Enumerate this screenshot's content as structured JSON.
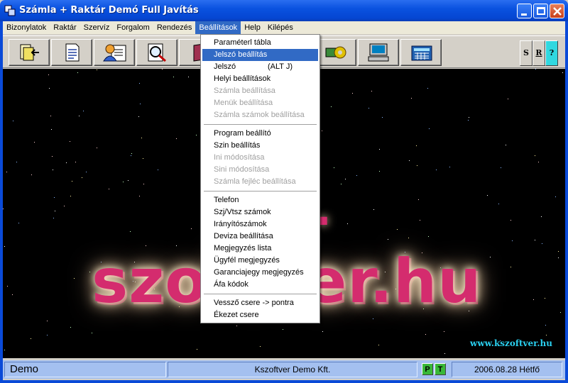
{
  "window": {
    "title": "Számla + Raktár Demó Full  Javítás"
  },
  "menu": [
    "Bizonylatok",
    "Raktár",
    "Szervíz",
    "Forgalom",
    "Rendezés",
    "Beállítások",
    "Help",
    "Kilépés"
  ],
  "active_menu": "Beállítások",
  "toolbar": {
    "side_buttons": [
      "S",
      "R",
      "?"
    ],
    "icons": [
      "document-exit-icon",
      "document-list-icon",
      "customer-card-icon",
      "search-magnifier-icon",
      "book-icon",
      "gear-money-icon",
      "computer-icon",
      "calculator-icon"
    ]
  },
  "dropdown": {
    "groups": [
      [
        {
          "label": "Paraméterl tábla",
          "state": "normal"
        },
        {
          "label": "Jelszó beállítás",
          "state": "selected"
        },
        {
          "label": "Jelszó",
          "shortcut": "(ALT J)",
          "state": "normal"
        },
        {
          "label": "Helyi beállítások",
          "state": "normal"
        },
        {
          "label": "Számla beállítása",
          "state": "disabled"
        },
        {
          "label": "Menük beállítása",
          "state": "disabled"
        },
        {
          "label": "Számla számok beállítása",
          "state": "disabled"
        }
      ],
      [
        {
          "label": "Program beállító",
          "state": "normal"
        },
        {
          "label": "Szin beállítás",
          "state": "normal"
        },
        {
          "label": "Ini  módosítása",
          "state": "disabled"
        },
        {
          "label": "Sini módosítása",
          "state": "disabled"
        },
        {
          "label": "Számla fejléc beállítása",
          "state": "disabled"
        }
      ],
      [
        {
          "label": "Telefon",
          "state": "normal"
        },
        {
          "label": "Szj/Vtsz számok",
          "state": "normal"
        },
        {
          "label": "Irányítószámok",
          "state": "normal"
        },
        {
          "label": "Deviza beállítása",
          "state": "normal"
        },
        {
          "label": "Megjegyzés lista",
          "state": "normal"
        },
        {
          "label": "Ügyfél megjegyzés",
          "state": "normal"
        },
        {
          "label": "Garanciajegy megjegyzés",
          "state": "normal"
        },
        {
          "label": "Áfa kódok",
          "state": "normal"
        }
      ],
      [
        {
          "label": "Vessző csere -> pontra",
          "state": "normal"
        },
        {
          "label": "Ékezet csere",
          "state": "normal"
        }
      ]
    ]
  },
  "background": {
    "logo_text": "szoftver.hu",
    "logo_fragment": ".",
    "url": "www.kszoftver.hu"
  },
  "status": {
    "left": "Demo",
    "company": "Kszoftver Demo Kft.",
    "p_label": "P",
    "t_label": "T",
    "date": "2006.08.28 Hétfő"
  },
  "colors": {
    "title_blue": "#0a52e0",
    "menu_highlight": "#316ac5",
    "logo_pink": "#d42c6e",
    "url_cyan": "#2ad0f0",
    "status_bg": "#a4c0f0"
  }
}
